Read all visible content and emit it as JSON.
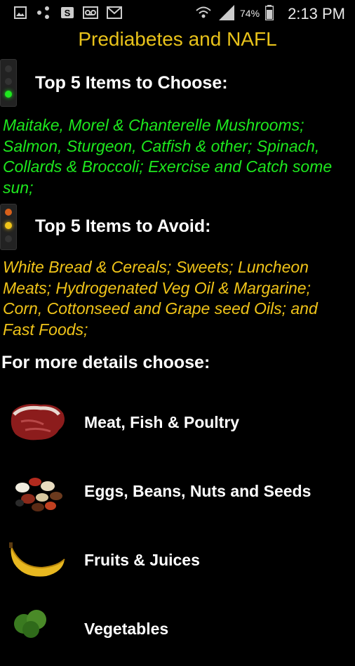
{
  "status_bar": {
    "time": "2:13 PM",
    "battery_percent": "74%",
    "icons": [
      "image-notification-icon",
      "share-notification-icon",
      "s-app-notification-icon",
      "voicemail-icon",
      "gmail-icon",
      "wifi-icon",
      "signal-icon",
      "battery-icon"
    ]
  },
  "app": {
    "title": "Prediabetes and NAFL"
  },
  "choose": {
    "heading": "Top 5 Items to Choose:",
    "lines": [
      "Maitake, Morel & Chanterelle Mushrooms;",
      "Salmon, Sturgeon, Catfish & other; Spinach,",
      "Collards & Broccoli; Exercise and Catch some",
      "sun;"
    ],
    "color": "#1ee81e"
  },
  "avoid": {
    "heading": "Top 5 Items to Avoid:",
    "lines": [
      "White Bread & Cereals; Sweets; Luncheon",
      "Meats; Hydrogenated Veg Oil & Margarine;",
      "Corn, Cottonseed and Grape seed Oils; and",
      "Fast Foods;"
    ],
    "color": "#f0c419"
  },
  "details": {
    "heading": "For more details choose:",
    "categories": [
      {
        "label": "Meat, Fish & Poultry",
        "icon": "steak-icon"
      },
      {
        "label": "Eggs, Beans, Nuts and Seeds",
        "icon": "beans-icon"
      },
      {
        "label": "Fruits & Juices",
        "icon": "banana-icon"
      },
      {
        "label": "Vegetables",
        "icon": "broccoli-icon"
      }
    ]
  },
  "colors": {
    "background": "#000000",
    "title": "#e8c21a",
    "heading": "#ffffff"
  }
}
